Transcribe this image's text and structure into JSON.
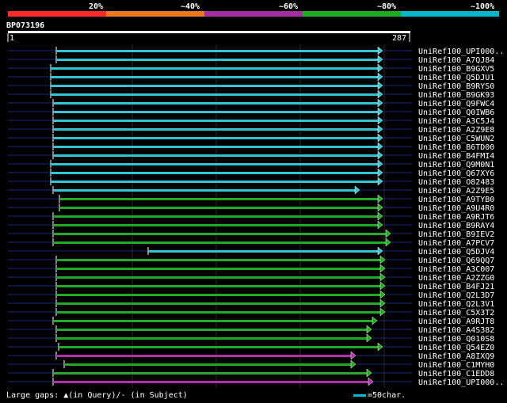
{
  "colors": {
    "bands": [
      "#ff2a2a",
      "#ee7722",
      "#a030a0",
      "#22aa22",
      "#00b8c8"
    ],
    "cyan": "#33c5d6",
    "green": "#22aa22",
    "magenta": "#b030b0",
    "query_line": "#1a2a7a"
  },
  "scale_labels": [
    "20%",
    "~40%",
    "~60%",
    "~80%",
    "~100%"
  ],
  "query": {
    "id": "BP073196",
    "start": "1",
    "end": "287",
    "length": 287
  },
  "footer": {
    "gaps": "Large gaps: ▲(in Query)/- (in Subject)",
    "legend": "=50char."
  },
  "hits": [
    {
      "label": "UniRef100_UPI000..",
      "start": 41,
      "end": 325,
      "color": "cyan"
    },
    {
      "label": "UniRef100_A7QJ84",
      "start": 41,
      "end": 325,
      "color": "cyan"
    },
    {
      "label": "UniRef100_B9GXV5",
      "start": 34,
      "end": 325,
      "color": "cyan"
    },
    {
      "label": "UniRef100_Q5DJU1",
      "start": 34,
      "end": 325,
      "color": "cyan"
    },
    {
      "label": "UniRef100_B9RYS0",
      "start": 34,
      "end": 325,
      "color": "cyan"
    },
    {
      "label": "UniRef100_B9GK93",
      "start": 34,
      "end": 325,
      "color": "cyan"
    },
    {
      "label": "UniRef100_Q9FWC4",
      "start": 37,
      "end": 325,
      "color": "cyan"
    },
    {
      "label": "UniRef100_Q0IWB6",
      "start": 37,
      "end": 325,
      "color": "cyan"
    },
    {
      "label": "UniRef100_A3C5J4",
      "start": 37,
      "end": 325,
      "color": "cyan"
    },
    {
      "label": "UniRef100_A2Z9E8",
      "start": 37,
      "end": 325,
      "color": "cyan"
    },
    {
      "label": "UniRef100_C5WUN2",
      "start": 37,
      "end": 325,
      "color": "cyan"
    },
    {
      "label": "UniRef100_B6TD00",
      "start": 37,
      "end": 325,
      "color": "cyan"
    },
    {
      "label": "UniRef100_B4FMI4",
      "start": 37,
      "end": 325,
      "color": "cyan"
    },
    {
      "label": "UniRef100_Q9M0N1",
      "start": 34,
      "end": 325,
      "color": "cyan"
    },
    {
      "label": "UniRef100_Q67XY6",
      "start": 34,
      "end": 325,
      "color": "cyan"
    },
    {
      "label": "UniRef100_O82483",
      "start": 34,
      "end": 325,
      "color": "cyan"
    },
    {
      "label": "UniRef100_A2Z9E5",
      "start": 37,
      "end": 296,
      "color": "cyan"
    },
    {
      "label": "UniRef100_A9TYB0",
      "start": 45,
      "end": 325,
      "color": "green"
    },
    {
      "label": "UniRef100_A9U4R0",
      "start": 45,
      "end": 325,
      "color": "green"
    },
    {
      "label": "UniRef100_A9RJT6",
      "start": 37,
      "end": 325,
      "color": "green"
    },
    {
      "label": "UniRef100_B9RAY4",
      "start": 37,
      "end": 325,
      "color": "green"
    },
    {
      "label": "UniRef100_B9IEV2",
      "start": 37,
      "end": 335,
      "color": "green"
    },
    {
      "label": "UniRef100_A7PCV7",
      "start": 37,
      "end": 335,
      "color": "green"
    },
    {
      "label": "UniRef100_Q5DJV4",
      "start": 157,
      "end": 325,
      "color": "cyan"
    },
    {
      "label": "UniRef100_Q69QQ7",
      "start": 41,
      "end": 328,
      "color": "green"
    },
    {
      "label": "UniRef100_A3C007",
      "start": 41,
      "end": 328,
      "color": "green"
    },
    {
      "label": "UniRef100_A2ZZG0",
      "start": 41,
      "end": 328,
      "color": "green"
    },
    {
      "label": "UniRef100_B4FJ21",
      "start": 41,
      "end": 328,
      "color": "green"
    },
    {
      "label": "UniRef100_Q2L3D7",
      "start": 41,
      "end": 328,
      "color": "green"
    },
    {
      "label": "UniRef100_Q2L3V1",
      "start": 41,
      "end": 328,
      "color": "green"
    },
    {
      "label": "UniRef100_C5X3T2",
      "start": 41,
      "end": 328,
      "color": "green"
    },
    {
      "label": "UniRef100_A9RJT8",
      "start": 37,
      "end": 318,
      "color": "green"
    },
    {
      "label": "UniRef100_A4S382",
      "start": 41,
      "end": 311,
      "color": "green"
    },
    {
      "label": "UniRef100_Q010S8",
      "start": 41,
      "end": 311,
      "color": "green"
    },
    {
      "label": "UniRef100_Q54EZ0",
      "start": 44,
      "end": 325,
      "color": "green"
    },
    {
      "label": "UniRef100_A8IXQ9",
      "start": 41,
      "end": 291,
      "color": "magenta"
    },
    {
      "label": "UniRef100_C1MYH0",
      "start": 51,
      "end": 291,
      "color": "green"
    },
    {
      "label": "UniRef100_C1EDD8",
      "start": 37,
      "end": 311,
      "color": "green"
    },
    {
      "label": "UniRef100_UPI000..",
      "start": 37,
      "end": 313,
      "color": "magenta"
    }
  ]
}
